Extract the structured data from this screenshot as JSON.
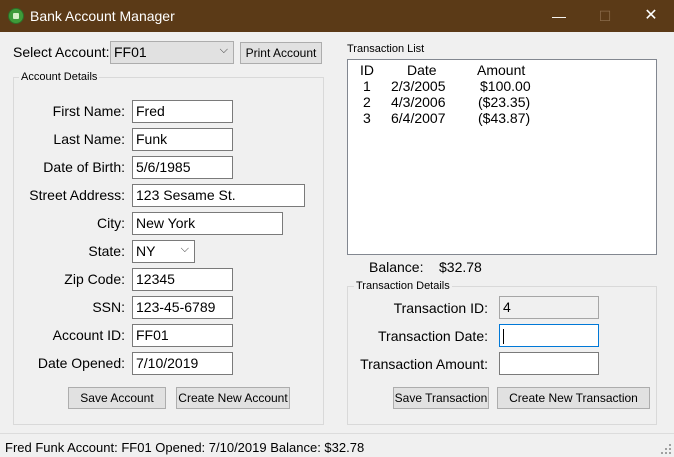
{
  "window": {
    "title": "Bank Account Manager",
    "minimize_glyph": "—",
    "maximize_glyph": "☐",
    "close_glyph": "✕"
  },
  "select_account": {
    "label": "Select Account:",
    "value": "FF01",
    "print_label": "Print Account"
  },
  "account_details": {
    "title": "Account Details",
    "fields": {
      "first_name": {
        "label": "First Name:",
        "value": "Fred"
      },
      "last_name": {
        "label": "Last Name:",
        "value": "Funk"
      },
      "dob": {
        "label": "Date of Birth:",
        "value": "5/6/1985"
      },
      "street": {
        "label": "Street Address:",
        "value": "123 Sesame St."
      },
      "city": {
        "label": "City:",
        "value": "New York"
      },
      "state": {
        "label": "State:",
        "value": "NY"
      },
      "zip": {
        "label": "Zip Code:",
        "value": "12345"
      },
      "ssn": {
        "label": "SSN:",
        "value": "123-45-6789"
      },
      "account_id": {
        "label": "Account ID:",
        "value": "FF01"
      },
      "date_opened": {
        "label": "Date Opened:",
        "value": "7/10/2019"
      }
    },
    "save_label": "Save Account",
    "create_label": "Create New Account"
  },
  "transaction_list": {
    "title": "Transaction List",
    "headers": {
      "id": "ID",
      "date": "Date",
      "amount": "Amount"
    },
    "rows": [
      {
        "id": "1",
        "date": "2/3/2005",
        "amount": "$100.00"
      },
      {
        "id": "2",
        "date": "4/3/2006",
        "amount": "($23.35)"
      },
      {
        "id": "3",
        "date": "6/4/2007",
        "amount": "($43.87)"
      }
    ]
  },
  "balance": {
    "label": "Balance:",
    "value": "$32.78"
  },
  "transaction_details": {
    "title": "Transaction Details",
    "id_label": "Transaction ID:",
    "id_value": "4",
    "date_label": "Transaction Date:",
    "date_value": "",
    "amount_label": "Transaction Amount:",
    "amount_value": "",
    "save_label": "Save Transaction",
    "create_label": "Create New Transaction"
  },
  "status": {
    "text": "Fred Funk  Account: FF01  Opened: 7/10/2019  Balance: $32.78"
  },
  "colors": {
    "titlebar": "#5b3a17",
    "window_bg": "#f0f0f0",
    "focus_border": "#0078d7"
  }
}
